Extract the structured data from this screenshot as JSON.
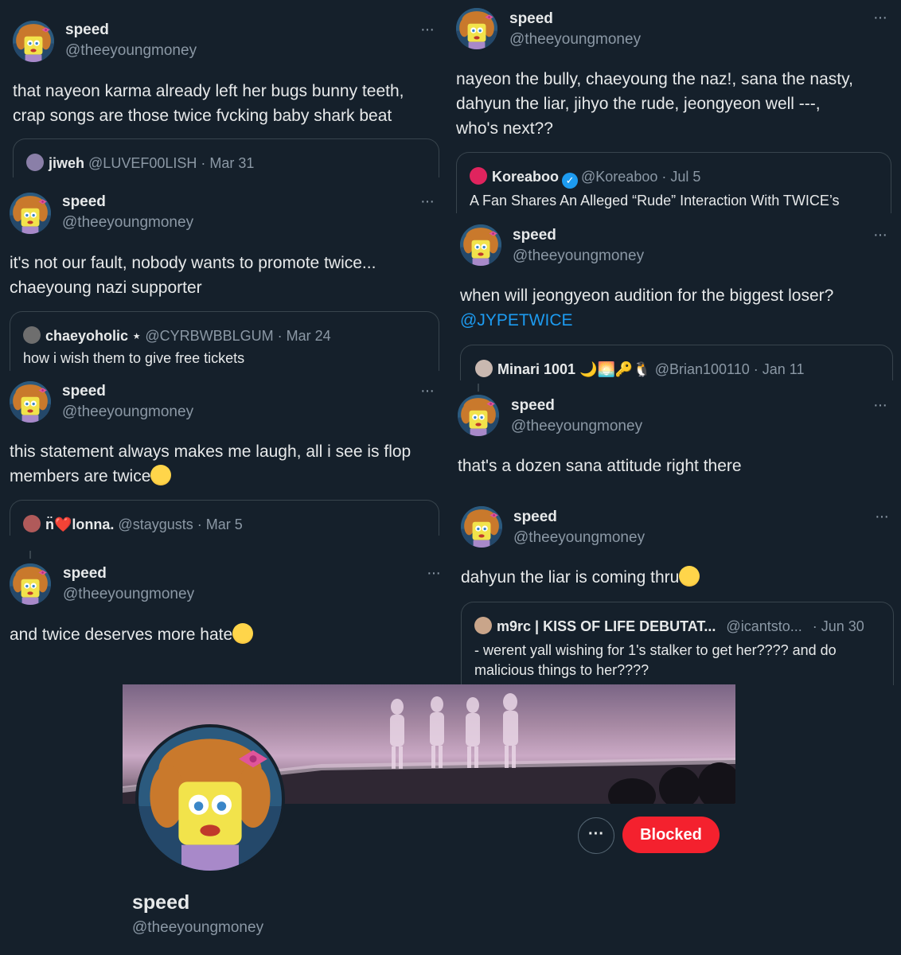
{
  "tweets": [
    {
      "name": "speed",
      "handle": "@theeyoungmoney",
      "text_lines": [
        "that nayeon karma already left her bugs bunny teeth,",
        "crap songs are those twice fvcking baby shark beat"
      ],
      "quote": {
        "name": "jiweh",
        "handle": "@LUVEF00LISH",
        "date": "· Mar 31",
        "text": ""
      }
    },
    {
      "name": "speed",
      "handle": "@theeyoungmoney",
      "text_lines": [
        "it's not our fault, nobody wants to promote twice...",
        "chaeyoung nazi supporter"
      ],
      "quote": {
        "name": "chaeyoholic ⋆",
        "handle": "@CYRBWBBLGUM",
        "date": "· Mar 24",
        "text": "how i wish them to give free tickets"
      }
    },
    {
      "name": "speed",
      "handle": "@theeyoungmoney",
      "text_lines": [
        "this statement always makes me laugh, all i see is flop",
        "members are twice"
      ],
      "quote": {
        "name": "n̈❤️lonna.",
        "handle": "@staygusts",
        "date": "· Mar 5",
        "text": ""
      }
    },
    {
      "name": "speed",
      "handle": "@theeyoungmoney",
      "text_lines": [
        "and twice deserves more hate"
      ]
    },
    {
      "name": "speed",
      "handle": "@theeyoungmoney",
      "text_lines": [
        "nayeon the bully, chaeyoung the naz!, sana the nasty,",
        "dahyun the liar, jihyo the rude, jeongyeon well ---,",
        "who's next??"
      ],
      "quote": {
        "name": "Koreaboo",
        "handle": "@Koreaboo",
        "date": "· Jul 5",
        "text": "A Fan Shares An Alleged “Rude” Interaction With TWICE’s"
      }
    },
    {
      "name": "speed",
      "handle": "@theeyoungmoney",
      "text_lines": [
        "when will jeongyeon audition for the biggest loser?"
      ],
      "mention": "@JYPETWICE",
      "quote": {
        "name": "Minari 1001 🌙🌅🔑🐧",
        "handle": "@Brian100110",
        "date": "· Jan 11",
        "text": ""
      }
    },
    {
      "name": "speed",
      "handle": "@theeyoungmoney",
      "text_lines": [
        "that's a dozen sana attitude right there"
      ]
    },
    {
      "name": "speed",
      "handle": "@theeyoungmoney",
      "text_lines": [
        "dahyun the liar is coming thru"
      ],
      "quote": {
        "name": "m9rc | KISS OF LIFE DEBUTAT...",
        "handle": "@icantsto...",
        "date": "· Jun 30",
        "text_lines": [
          "- werent yall wishing for 1's stalker to get her???? and do",
          "malicious things to her????"
        ]
      }
    }
  ],
  "more_glyph": "···",
  "profile": {
    "name": "speed",
    "handle": "@theeyoungmoney",
    "more_glyph": "···",
    "blocked_label": "Blocked"
  },
  "colors": {
    "background": "#15202b",
    "link": "#1d9bf0",
    "blocked": "#f4212e",
    "muted": "#8b98a5"
  },
  "icons": {
    "avatar": "spongebob-wig-avatar",
    "verified": "verified-badge-icon",
    "more": "more-options-icon",
    "emoji_cry": "loudly-crying-face-emoji",
    "emoji_relieved": "relieved-face-emoji",
    "emoji_zipper": "zipper-mouth-face-emoji"
  }
}
